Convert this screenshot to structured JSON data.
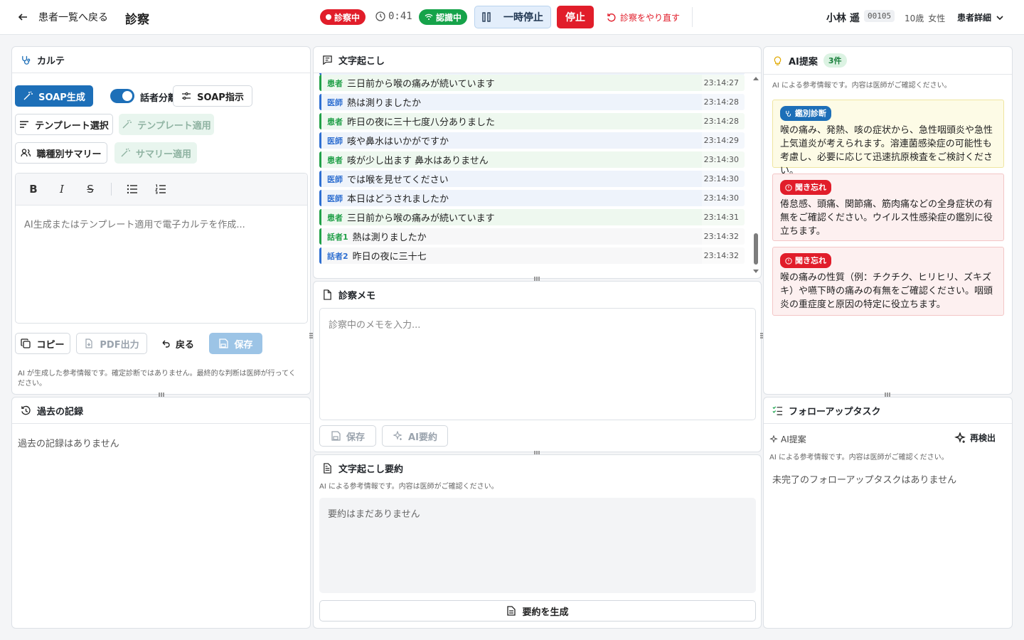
{
  "header": {
    "back_label": "患者一覧へ戻る",
    "title": "診察",
    "recording_label": "診察中",
    "timer": "0:41",
    "recognition_label": "認識中",
    "pause_label": "一時停止",
    "stop_label": "停止",
    "redo_label": "診察をやり直す",
    "patient_name": "小林 遥",
    "patient_id": "00105",
    "patient_age": "10歳",
    "patient_sex": "女性",
    "patient_detail_label": "患者詳細"
  },
  "karte": {
    "title": "カルテ",
    "soap_generate": "SOAP生成",
    "speaker_toggle_label": "話者分離",
    "soap_instruction": "SOAP指示",
    "template_select": "テンプレート選択",
    "template_apply": "テンプレート適用",
    "role_summary": "職種別サマリー",
    "summary_apply": "サマリー適用",
    "editor_placeholder": "AI生成またはテンプレート適用で電子カルテを作成...",
    "copy": "コピー",
    "pdf": "PDF出力",
    "undo": "戻る",
    "save": "保存",
    "disclaimer": "AI が生成した参考情報です。確定診断ではありません。最終的な判断は医師が行ってください。"
  },
  "history": {
    "title": "過去の記録",
    "empty": "過去の記録はありません"
  },
  "transcript": {
    "title": "文字起こし",
    "rows": [
      {
        "role": "pt",
        "who": "患者",
        "text": "三日前から喉の痛みが続いています",
        "time": "23:14:27"
      },
      {
        "role": "dr",
        "who": "医師",
        "text": "熱は測りましたか",
        "time": "23:14:28"
      },
      {
        "role": "pt",
        "who": "患者",
        "text": "昨日の夜に三十七度八分ありました",
        "time": "23:14:28"
      },
      {
        "role": "dr",
        "who": "医師",
        "text": "咳や鼻水はいかがですか",
        "time": "23:14:29"
      },
      {
        "role": "pt",
        "who": "患者",
        "text": "咳が少し出ます 鼻水はありません",
        "time": "23:14:30"
      },
      {
        "role": "dr",
        "who": "医師",
        "text": "では喉を見せてください",
        "time": "23:14:30"
      },
      {
        "role": "dr",
        "who": "医師",
        "text": "本日はどうされましたか",
        "time": "23:14:30"
      },
      {
        "role": "pt",
        "who": "患者",
        "text": "三日前から喉の痛みが続いています",
        "time": "23:14:31"
      },
      {
        "role": "sp1",
        "who": "話者1",
        "text": "熱は測りましたか",
        "time": "23:14:32"
      },
      {
        "role": "sp2",
        "who": "話者2",
        "text": "昨日の夜に三十七",
        "time": "23:14:32"
      }
    ]
  },
  "memo": {
    "title": "診察メモ",
    "placeholder": "診察中のメモを入力...",
    "save": "保存",
    "ai_summary": "AI要約"
  },
  "summary": {
    "title": "文字起こし要約",
    "note": "AI による参考情報です。内容は医師がご確認ください。",
    "empty": "要約はまだありません",
    "generate": "要約を生成"
  },
  "ai": {
    "title": "AI提案",
    "count": "3件",
    "note": "AI による参考情報です。内容は医師がご確認ください。",
    "cards": [
      {
        "tag": "鑑別診断",
        "text": "喉の痛み、発熱、咳の症状から、急性咽頭炎や急性上気道炎が考えられます。溶連菌感染症の可能性も考慮し、必要に応じて迅速抗原検査をご検討ください。"
      },
      {
        "tag": "聞き忘れ",
        "text": "倦怠感、頭痛、関節痛、筋肉痛などの全身症状の有無をご確認ください。ウイルス性感染症の鑑別に役立ちます。"
      },
      {
        "tag": "聞き忘れ",
        "text": "喉の痛みの性質（例：チクチク、ヒリヒリ、ズキズキ）や嚥下時の痛みの有無をご確認ください。咽頭炎の重症度と原因の特定に役立ちます。"
      }
    ]
  },
  "followup": {
    "title": "フォローアップタスク",
    "ai_label": "AI提案",
    "redetect": "再検出",
    "note": "AI による参考情報です。内容は医師がご確認ください。",
    "empty": "未完了のフォローアップタスクはありません"
  },
  "colors": {
    "primary": "#1d6fb8",
    "danger": "#e11d2a",
    "success": "#16a34a"
  }
}
